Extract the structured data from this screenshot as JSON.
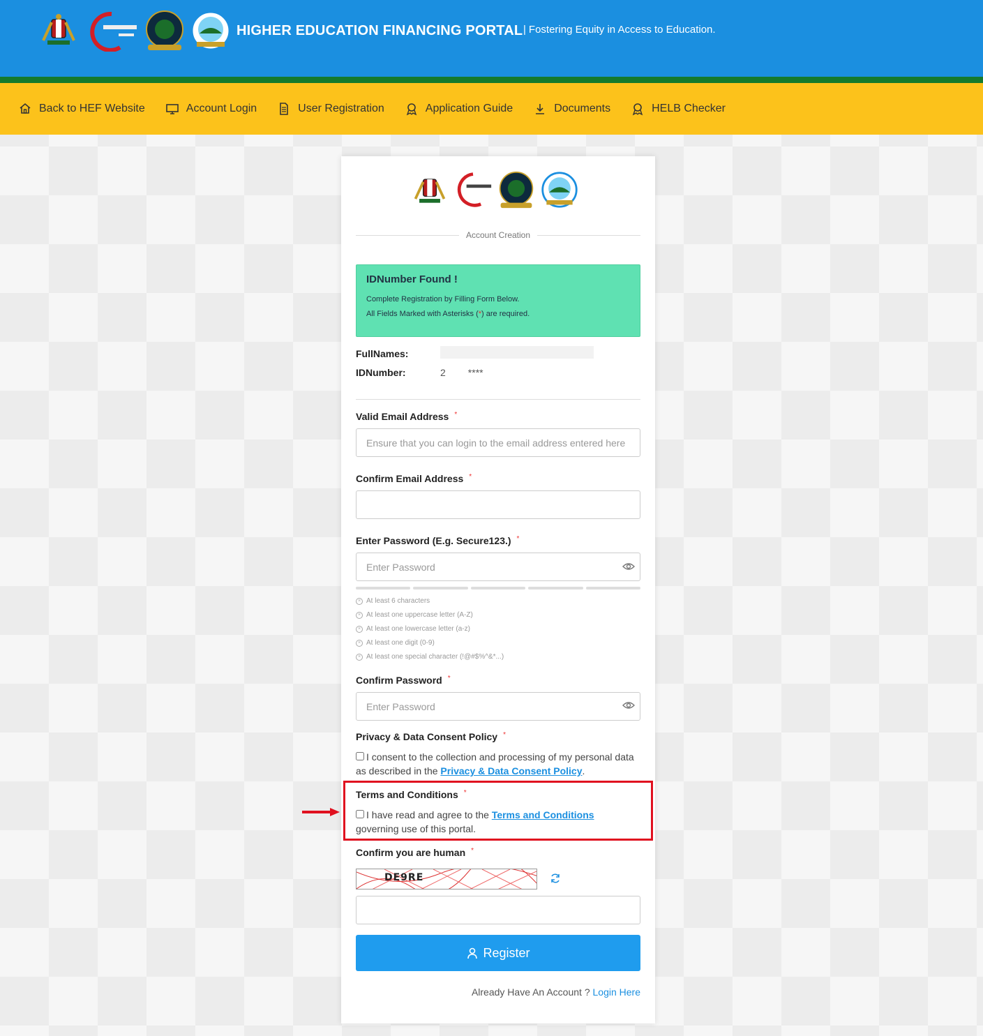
{
  "header": {
    "title": "HIGHER EDUCATION FINANCING PORTAL",
    "tagline": "Fostering Equity in Access to Education."
  },
  "nav": {
    "items": [
      {
        "label": "Back to HEF Website",
        "icon": "home-icon"
      },
      {
        "label": "Account Login",
        "icon": "monitor-icon"
      },
      {
        "label": "User Registration",
        "icon": "document-icon"
      },
      {
        "label": "Application Guide",
        "icon": "award-icon"
      },
      {
        "label": "Documents",
        "icon": "download-icon"
      },
      {
        "label": "HELB Checker",
        "icon": "award-icon"
      }
    ]
  },
  "card": {
    "section_title": "Account Creation",
    "alert": {
      "title": "IDNumber Found !",
      "line1": "Complete Registration by Filling Form Below.",
      "line2_pre": "All Fields Marked with Asterisks (",
      "line2_ast": "*",
      "line2_post": ") are required."
    },
    "info": {
      "fullnames_label": "FullNames:",
      "idnumber_label": "IDNumber:",
      "idnumber_prefix": "2",
      "idnumber_suffix": "****"
    },
    "email": {
      "label": "Valid Email Address",
      "placeholder": "Ensure that you can login to the email address entered here"
    },
    "confirm_email": {
      "label": "Confirm Email Address",
      "placeholder": ""
    },
    "password": {
      "label": "Enter Password (E.g. Secure123.)",
      "placeholder": "Enter Password"
    },
    "password_rules": [
      "At least 6 characters",
      "At least one uppercase letter (A-Z)",
      "At least one lowercase letter (a-z)",
      "At least one digit (0-9)",
      "At least one special character (!@#$%^&*...)"
    ],
    "confirm_password": {
      "label": "Confirm Password",
      "placeholder": "Enter Password"
    },
    "privacy": {
      "label": "Privacy & Data Consent Policy",
      "text_pre": "I consent to the collection and processing of my personal data as described in the ",
      "link": "Privacy & Data Consent Policy",
      "text_post": "."
    },
    "terms": {
      "label": "Terms and Conditions",
      "text_pre": "I have read and agree to the ",
      "link": "Terms and Conditions",
      "text_post": " governing use of this portal."
    },
    "captcha": {
      "label": "Confirm you are human",
      "code": "DE9RE",
      "placeholder": ""
    },
    "required_mark": "*",
    "register_label": "Register",
    "login_prompt": "Already Have An Account ?",
    "login_link": "Login Here"
  },
  "colors": {
    "header_blue": "#1b8fe0",
    "nav_yellow": "#fcc21b",
    "alert_green": "#5fe1b2",
    "register_blue": "#1f9cee",
    "highlight_red": "#e0101f"
  }
}
